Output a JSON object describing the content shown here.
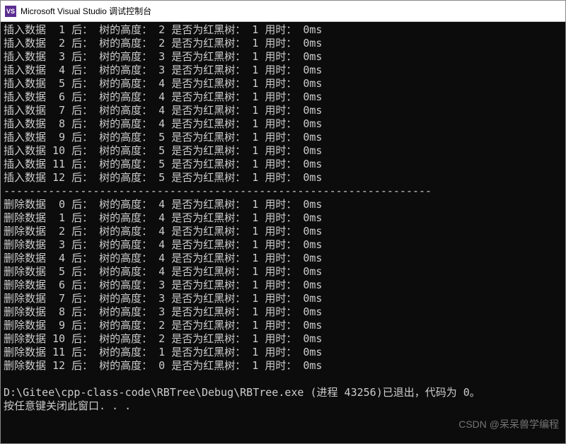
{
  "window": {
    "icon_label": "VS",
    "title": "Microsoft Visual Studio 调试控制台"
  },
  "console": {
    "insert_label": "插入数据",
    "delete_label": "删除数据",
    "after_label": "后：",
    "height_label": "树的高度：",
    "isrb_label": "是否为红黑树：",
    "time_label": "用时：",
    "time_unit": "ms",
    "inserts": [
      {
        "n": 1,
        "h": 2,
        "rb": 1,
        "t": 0
      },
      {
        "n": 2,
        "h": 2,
        "rb": 1,
        "t": 0
      },
      {
        "n": 3,
        "h": 3,
        "rb": 1,
        "t": 0
      },
      {
        "n": 4,
        "h": 3,
        "rb": 1,
        "t": 0
      },
      {
        "n": 5,
        "h": 4,
        "rb": 1,
        "t": 0
      },
      {
        "n": 6,
        "h": 4,
        "rb": 1,
        "t": 0
      },
      {
        "n": 7,
        "h": 4,
        "rb": 1,
        "t": 0
      },
      {
        "n": 8,
        "h": 4,
        "rb": 1,
        "t": 0
      },
      {
        "n": 9,
        "h": 5,
        "rb": 1,
        "t": 0
      },
      {
        "n": 10,
        "h": 5,
        "rb": 1,
        "t": 0
      },
      {
        "n": 11,
        "h": 5,
        "rb": 1,
        "t": 0
      },
      {
        "n": 12,
        "h": 5,
        "rb": 1,
        "t": 0
      }
    ],
    "separator": "-------------------------------------------------------------------",
    "deletes": [
      {
        "n": 0,
        "h": 4,
        "rb": 1,
        "t": 0
      },
      {
        "n": 1,
        "h": 4,
        "rb": 1,
        "t": 0
      },
      {
        "n": 2,
        "h": 4,
        "rb": 1,
        "t": 0
      },
      {
        "n": 3,
        "h": 4,
        "rb": 1,
        "t": 0
      },
      {
        "n": 4,
        "h": 4,
        "rb": 1,
        "t": 0
      },
      {
        "n": 5,
        "h": 4,
        "rb": 1,
        "t": 0
      },
      {
        "n": 6,
        "h": 3,
        "rb": 1,
        "t": 0
      },
      {
        "n": 7,
        "h": 3,
        "rb": 1,
        "t": 0
      },
      {
        "n": 8,
        "h": 3,
        "rb": 1,
        "t": 0
      },
      {
        "n": 9,
        "h": 2,
        "rb": 1,
        "t": 0
      },
      {
        "n": 10,
        "h": 2,
        "rb": 1,
        "t": 0
      },
      {
        "n": 11,
        "h": 1,
        "rb": 1,
        "t": 0
      },
      {
        "n": 12,
        "h": 0,
        "rb": 1,
        "t": 0
      }
    ],
    "exit_line": "D:\\Gitee\\cpp-class-code\\RBTree\\Debug\\RBTree.exe (进程 43256)已退出，代码为 0。",
    "close_line": "按任意键关闭此窗口. . ."
  },
  "watermark": "CSDN @呆呆兽学编程"
}
